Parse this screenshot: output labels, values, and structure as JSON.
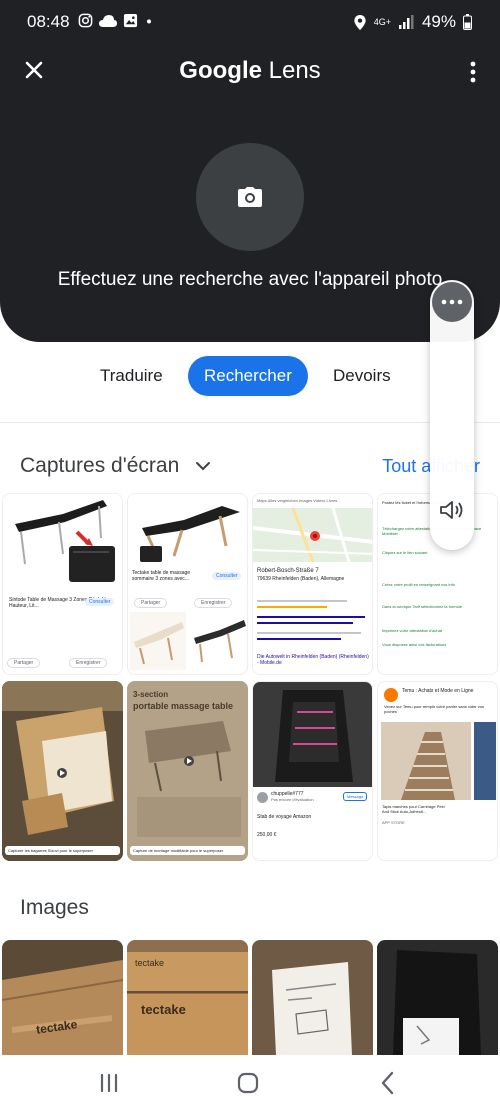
{
  "status": {
    "time": "08:48",
    "network": "4G+",
    "battery": "49%"
  },
  "header": {
    "title_google": "Google",
    "title_lens": "Lens"
  },
  "camera": {
    "prompt": "Effectuez une recherche avec l'appareil photo"
  },
  "tabs": [
    {
      "label": "Traduire"
    },
    {
      "label": "Rechercher"
    },
    {
      "label": "Devoirs"
    }
  ],
  "screenshots": {
    "title": "Captures d'écran",
    "see_all": "Tout afficher",
    "tiles": [
      {
        "caption": "Sintode Table de Massage 3 Zones Réglable Hauteur, Lit...",
        "chip": "Consulter",
        "action1": "Partager",
        "action2": "Enregistrer"
      },
      {
        "caption": "Tectake table de massage sommaire 3 zones avec...",
        "chip": "Consulter",
        "action1": "Partager",
        "action2": "Enregistrer"
      },
      {
        "place": "Robert-Bosch-Straße 7",
        "address": "79639 Rheinfelden (Baden), Allemagne",
        "link1": "Die Autowelt in Rheinfelden (Baden) (Rheinfelden) - Mobile.de",
        "tabs": "Maps  Alles vergleichen  Images  Vidéos  Livres"
      },
      {
        "header": "Postez les ticket et l'information de livraison",
        "item1": "Téléchargez votre attestation d'achat dans votre espace Mobiliser",
        "item2": "Cliquez sur le lien suivant",
        "item3": "Créez votre profil en renseignant vos info",
        "item4": "Dans la rubrique Tarif sélectionnez la formule",
        "item5": "Imprimez votre attestation d'achat",
        "item6": "Vous disposez ainsi vos facturations"
      },
      {
        "banner": "Capturer les bagarres Sizovi pour le superposer"
      },
      {
        "heading1": "3-section",
        "heading2": "portable massage table",
        "banner": "Capture de montage modifiable pour le superposer"
      },
      {
        "seller": "chuppelle#777",
        "rating": "Pas encore d'évaluation",
        "item": "Stab de voyage Amazon",
        "price": "250,00 €",
        "chip": "Message"
      },
      {
        "page": "Temu : Achats et Mode en Ligne",
        "text": "Venez sur Temu pour remplir votre panier sans vider vos poches",
        "product": "Tapis marches pour Carrelage Peel And Stick Auto-Adhésif...",
        "price": "APP STORE"
      }
    ]
  },
  "images": {
    "title": "Images",
    "brand": "tectake",
    "label1": "tectake",
    "label2": "tectake"
  },
  "colors": {
    "panel_bg": "#202124",
    "accent": "#1a73e8"
  }
}
